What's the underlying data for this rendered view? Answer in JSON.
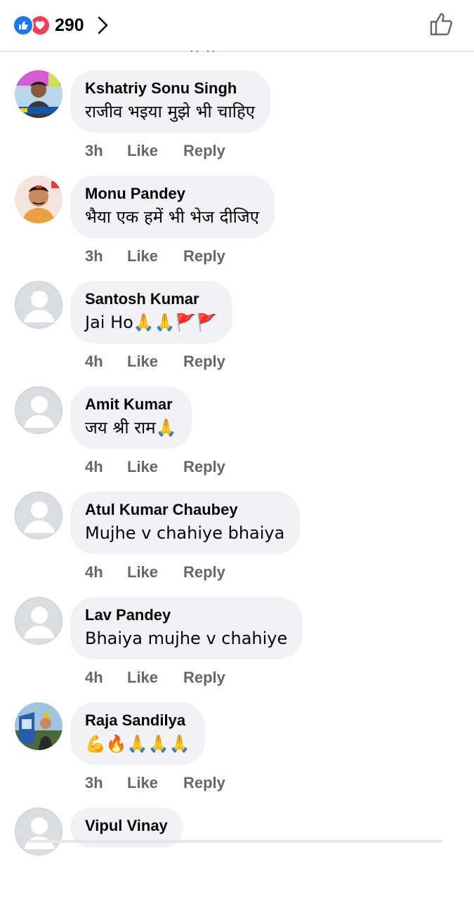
{
  "header": {
    "reaction_count": "290",
    "peek_text": "·· ··"
  },
  "comments": [
    {
      "author": "Kshatriy Sonu Singh",
      "text": "राजीव भइया मुझे भी चाहिए",
      "time": "3h",
      "like": "Like",
      "reply": "Reply",
      "avatar": "photo"
    },
    {
      "author": "Monu Pandey",
      "text": "भैया एक हमें भी भेज दीजिए",
      "time": "3h",
      "like": "Like",
      "reply": "Reply",
      "avatar": "photo"
    },
    {
      "author": "Santosh Kumar",
      "text": "Jai Ho🙏🙏🚩🚩",
      "time": "4h",
      "like": "Like",
      "reply": "Reply",
      "avatar": "default"
    },
    {
      "author": "Amit Kumar",
      "text": "जय श्री राम🙏",
      "time": "4h",
      "like": "Like",
      "reply": "Reply",
      "avatar": "default"
    },
    {
      "author": "Atul Kumar Chaubey",
      "text": "Mujhe v chahiye bhaiya",
      "time": "4h",
      "like": "Like",
      "reply": "Reply",
      "avatar": "default"
    },
    {
      "author": "Lav Pandey",
      "text": "Bhaiya mujhe v chahiye",
      "time": "4h",
      "like": "Like",
      "reply": "Reply",
      "avatar": "default"
    },
    {
      "author": "Raja Sandilya",
      "text": "💪🔥🙏🙏🙏",
      "time": "3h",
      "like": "Like",
      "reply": "Reply",
      "avatar": "photo"
    },
    {
      "author": "Vipul Vinay",
      "text": "",
      "time": "",
      "like": "",
      "reply": "",
      "avatar": "default"
    }
  ],
  "colors": {
    "accent_blue": "#1877f2",
    "love_red": "#f33e58",
    "bubble_bg": "#f0f2f5",
    "meta_gray": "#65676b"
  },
  "icons": [
    "like-reaction-icon",
    "love-reaction-icon",
    "chevron-right-icon",
    "thumbs-up-outline-icon",
    "default-avatar-icon"
  ]
}
